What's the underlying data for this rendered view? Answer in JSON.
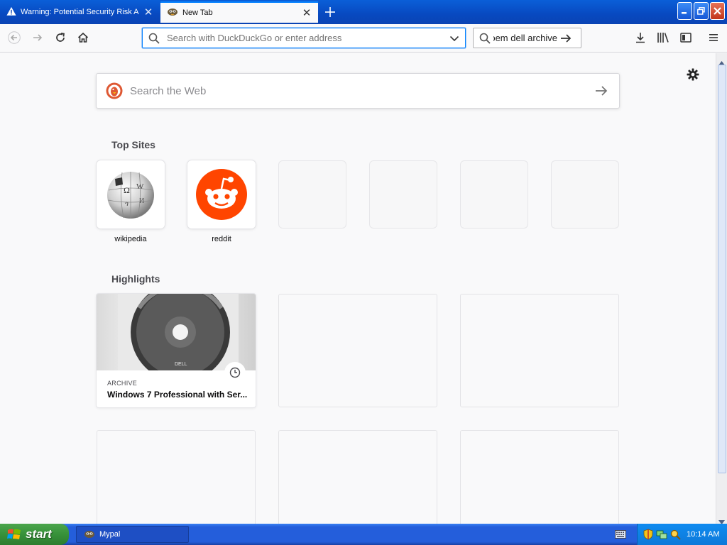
{
  "window": {
    "tabs": [
      {
        "label": "Warning: Potential Security Risk A",
        "active": false,
        "icon": "warning-icon"
      },
      {
        "label": "New Tab",
        "active": true,
        "icon": "mypal-icon"
      }
    ]
  },
  "navbar": {
    "url_placeholder": "Search with DuckDuckGo or enter address",
    "search_value": "oem dell archive"
  },
  "newtab": {
    "websearch_placeholder": "Search the Web",
    "top_sites_title": "Top Sites",
    "top_sites": [
      {
        "label": "wikipedia",
        "icon": "wikipedia-icon"
      },
      {
        "label": "reddit",
        "icon": "reddit-icon"
      }
    ],
    "highlights_title": "Highlights",
    "highlights": [
      {
        "context": "ARCHIVE",
        "title": "Windows 7 Professional with Ser..."
      }
    ]
  },
  "taskbar": {
    "start_label": "start",
    "tasks": [
      {
        "label": "Mypal"
      }
    ],
    "clock": "10:14 AM"
  },
  "colors": {
    "accent": "#0a84ff",
    "reddit": "#ff4500",
    "xp_blue": "#245edb",
    "xp_green": "#37913a"
  }
}
